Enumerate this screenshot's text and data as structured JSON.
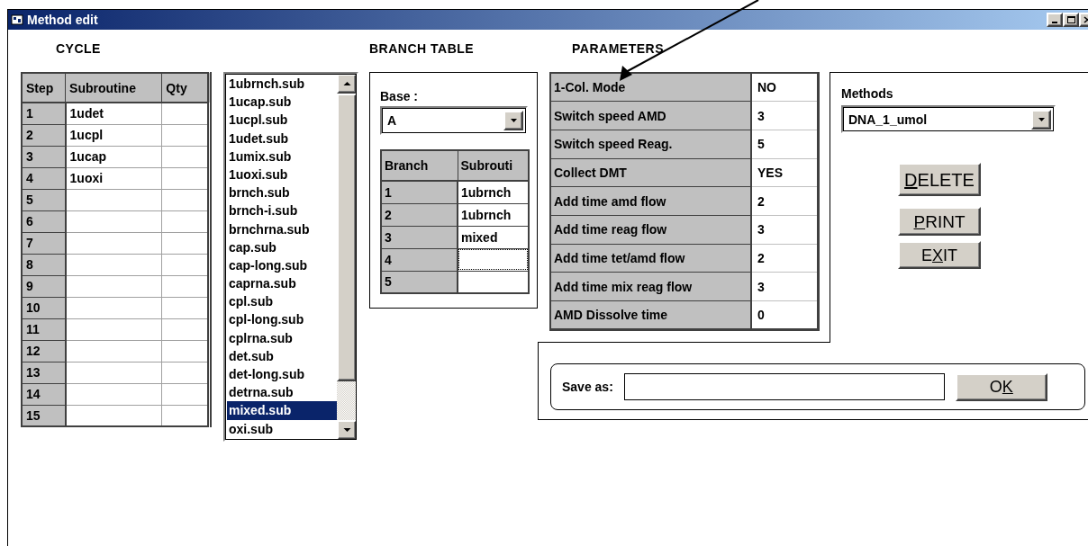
{
  "window": {
    "title": "Method edit"
  },
  "cycle": {
    "heading": "CYCLE",
    "columns": [
      "Step",
      "Subroutine",
      "Qty"
    ],
    "rows": [
      {
        "step": "1",
        "subroutine": "1udet"
      },
      {
        "step": "2",
        "subroutine": "1ucpl"
      },
      {
        "step": "3",
        "subroutine": "1ucap"
      },
      {
        "step": "4",
        "subroutine": "1uoxi"
      },
      {
        "step": "5"
      },
      {
        "step": "6"
      },
      {
        "step": "7"
      },
      {
        "step": "8"
      },
      {
        "step": "9"
      },
      {
        "step": "10"
      },
      {
        "step": "11"
      },
      {
        "step": "12"
      },
      {
        "step": "13"
      },
      {
        "step": "14"
      },
      {
        "step": "15"
      }
    ]
  },
  "subroutine_list": {
    "items": [
      {
        "label": "1ubrnch.sub",
        "selected": false
      },
      {
        "label": "1ucap.sub",
        "selected": false
      },
      {
        "label": "1ucpl.sub",
        "selected": false
      },
      {
        "label": "1udet.sub",
        "selected": false
      },
      {
        "label": "1umix.sub",
        "selected": false
      },
      {
        "label": "1uoxi.sub",
        "selected": false
      },
      {
        "label": "brnch.sub",
        "selected": false
      },
      {
        "label": "brnch-i.sub",
        "selected": false
      },
      {
        "label": "brnchrna.sub",
        "selected": false
      },
      {
        "label": "cap.sub",
        "selected": false
      },
      {
        "label": "cap-long.sub",
        "selected": false
      },
      {
        "label": "caprna.sub",
        "selected": false
      },
      {
        "label": "cpl.sub",
        "selected": false
      },
      {
        "label": "cpl-long.sub",
        "selected": false
      },
      {
        "label": "cplrna.sub",
        "selected": false
      },
      {
        "label": "det.sub",
        "selected": false
      },
      {
        "label": "det-long.sub",
        "selected": false
      },
      {
        "label": "detrna.sub",
        "selected": false
      },
      {
        "label": "mixed.sub",
        "selected": true
      },
      {
        "label": "oxi.sub",
        "selected": false
      }
    ]
  },
  "branch_table": {
    "heading": "BRANCH TABLE",
    "base_label": "Base :",
    "base_value": "A",
    "columns": [
      "Branch",
      "Subrouti"
    ],
    "rows": [
      {
        "branch": "1",
        "subroutine": "1ubrnch",
        "focused": false
      },
      {
        "branch": "2",
        "subroutine": "1ubrnch",
        "focused": false
      },
      {
        "branch": "3",
        "subroutine": "mixed",
        "focused": false
      },
      {
        "branch": "4",
        "focused": true
      },
      {
        "branch": "5",
        "focused": false
      }
    ]
  },
  "parameters": {
    "heading": "PARAMETERS",
    "rows": [
      {
        "name": "1-Col. Mode",
        "value": "NO"
      },
      {
        "name": "Switch speed AMD",
        "value": "3"
      },
      {
        "name": "Switch speed Reag.",
        "value": "5"
      },
      {
        "name": "Collect DMT",
        "value": "YES"
      },
      {
        "name": "Add time amd flow",
        "value": "2"
      },
      {
        "name": "Add time reag flow",
        "value": "3"
      },
      {
        "name": "Add time tet/amd flow",
        "value": "2"
      },
      {
        "name": "Add time mix reag flow",
        "value": "3"
      },
      {
        "name": "AMD Dissolve time",
        "value": "0"
      }
    ]
  },
  "methods": {
    "label": "Methods",
    "value": "DNA_1_umol",
    "buttons": [
      {
        "kind": "delete",
        "mnemonic": "D",
        "after": "ELETE"
      },
      {
        "kind": "print",
        "mnemonic": "P",
        "after": "RINT"
      },
      {
        "kind": "exit",
        "before": "E",
        "mnemonic": "X",
        "after": "IT"
      }
    ]
  },
  "save": {
    "label": "Save as:",
    "button": {
      "before": "O",
      "mnemonic": "K"
    }
  }
}
